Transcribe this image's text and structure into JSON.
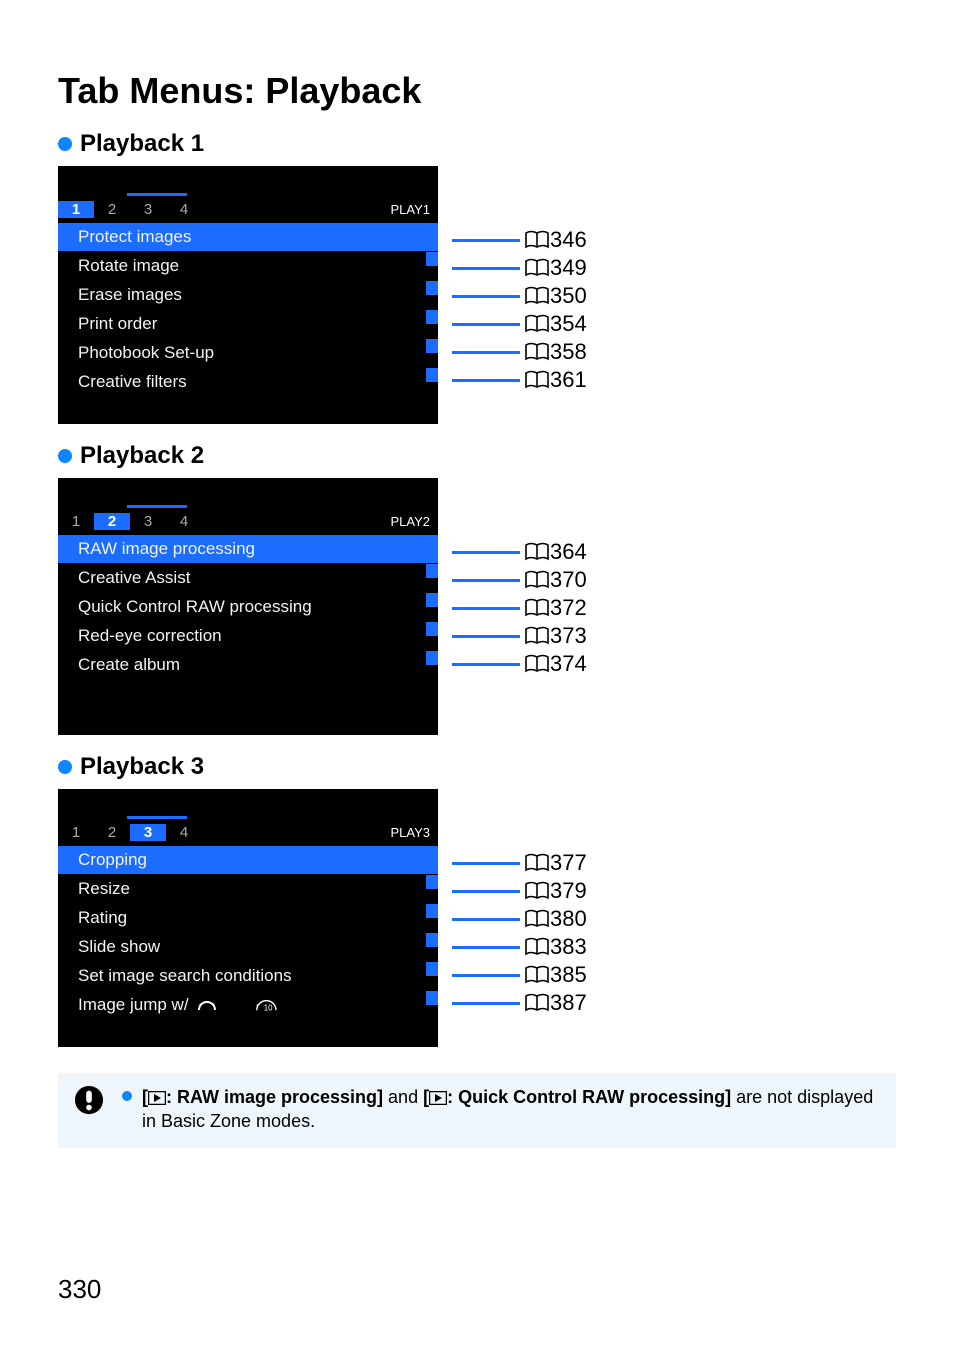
{
  "page_title": "Tab Menus: Playback",
  "page_number": "330",
  "sections": [
    {
      "heading": "Playback 1",
      "tag": "PLAY1",
      "active_sub": 1,
      "items": [
        {
          "label": "Protect images",
          "page": "346"
        },
        {
          "label": "Rotate image",
          "page": "349"
        },
        {
          "label": "Erase images",
          "page": "350"
        },
        {
          "label": "Print order",
          "page": "354"
        },
        {
          "label": "Photobook Set-up",
          "page": "358"
        },
        {
          "label": "Creative filters",
          "page": "361"
        }
      ],
      "filler_rows": 1
    },
    {
      "heading": "Playback 2",
      "tag": "PLAY2",
      "active_sub": 2,
      "items": [
        {
          "label": "RAW image processing",
          "page": "364"
        },
        {
          "label": "Creative Assist",
          "page": "370"
        },
        {
          "label": "Quick Control RAW processing",
          "page": "372"
        },
        {
          "label": "Red-eye correction",
          "page": "373"
        },
        {
          "label": "Create album",
          "page": "374"
        }
      ],
      "filler_rows": 2
    },
    {
      "heading": "Playback 3",
      "tag": "PLAY3",
      "active_sub": 3,
      "items": [
        {
          "label": "Cropping",
          "page": "377"
        },
        {
          "label": "Resize",
          "page": "379"
        },
        {
          "label": "Rating",
          "page": "380"
        },
        {
          "label": "Slide show",
          "page": "383"
        },
        {
          "label": "Set image search conditions",
          "page": "385"
        },
        {
          "label": "Image jump w/",
          "page": "387",
          "extra": "dial_jump10"
        }
      ],
      "filler_rows": 1
    }
  ],
  "note": {
    "bold1": ": RAW image processing]",
    "mid": " and ",
    "bold2": ": Quick Control RAW processing]",
    "tail": " are not displayed in Basic Zone modes."
  }
}
